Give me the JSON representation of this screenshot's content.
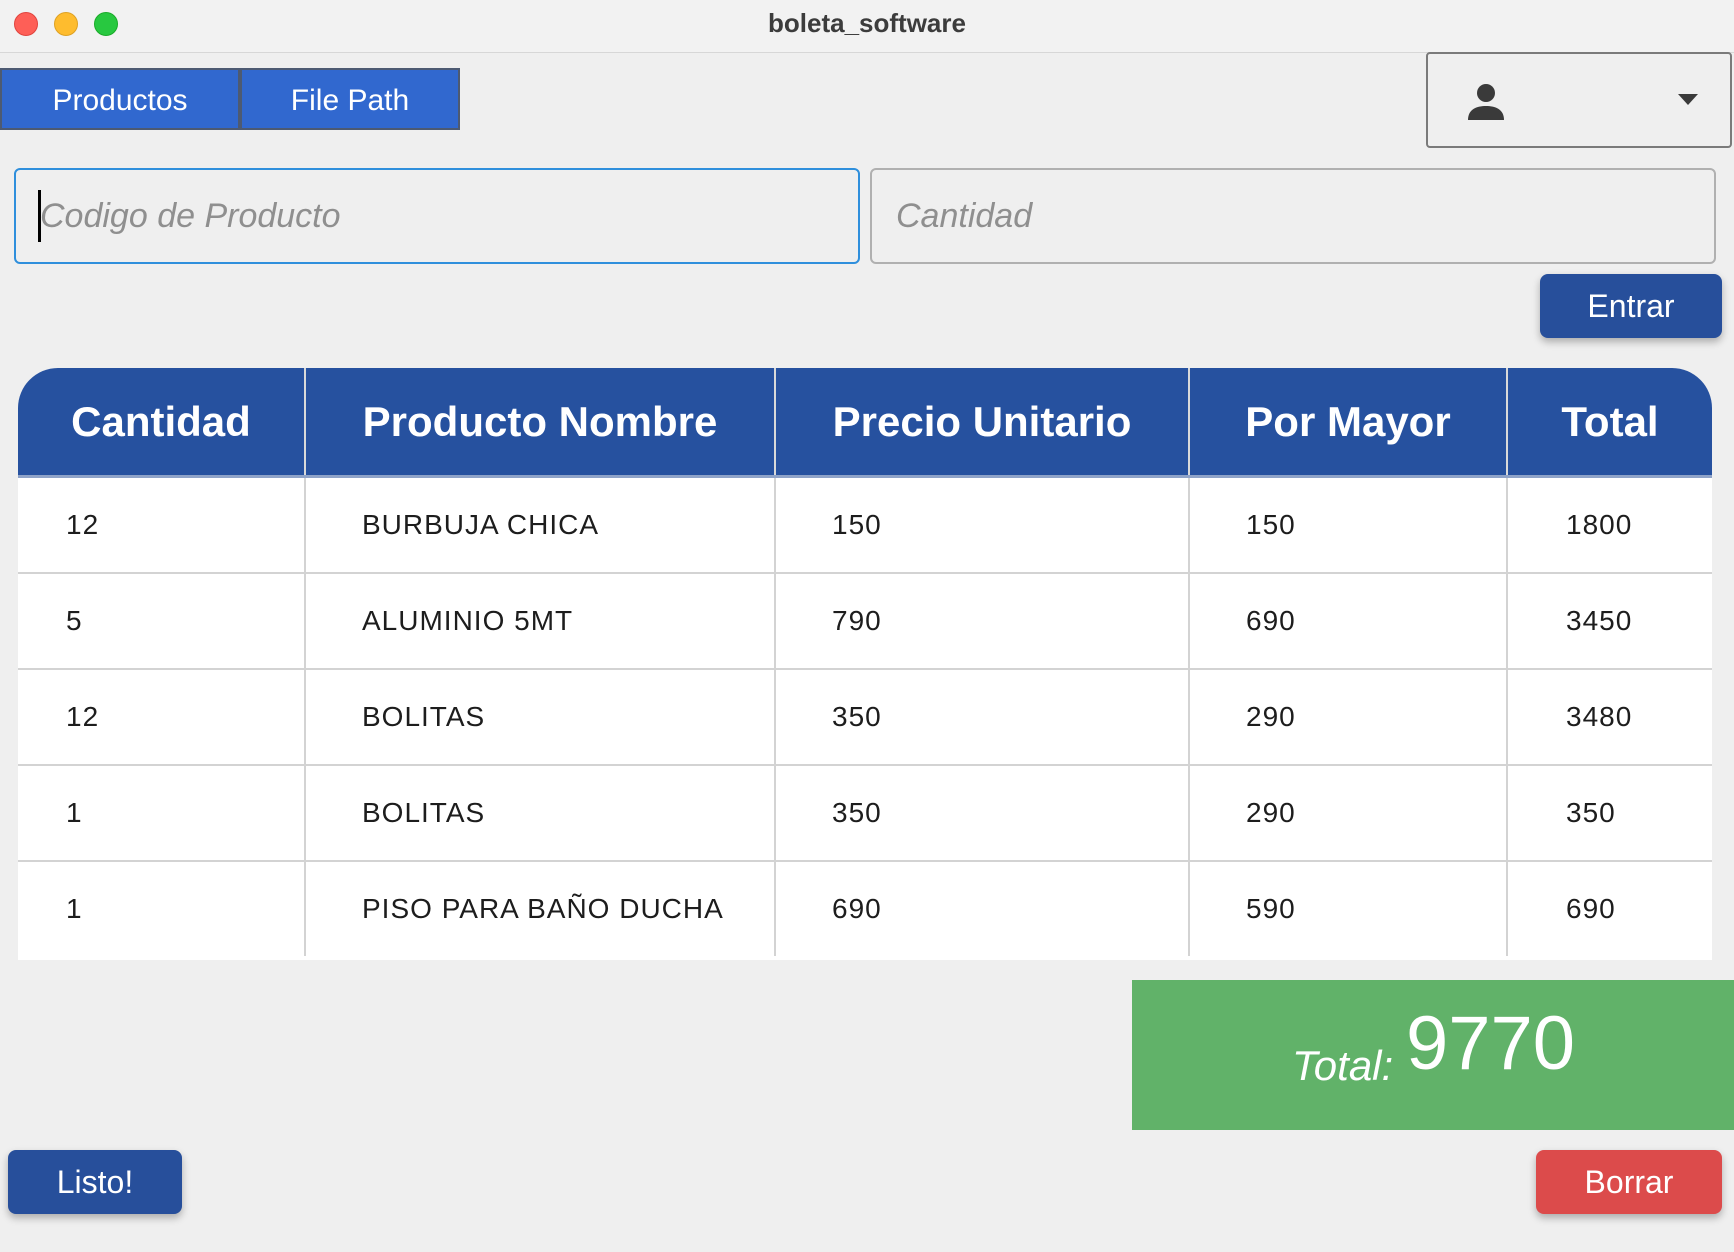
{
  "window": {
    "title": "boleta_software"
  },
  "menu": {
    "items": [
      {
        "label": "Productos"
      },
      {
        "label": "File Path"
      }
    ]
  },
  "user_dropdown": {
    "icon": "user-icon"
  },
  "inputs": {
    "codigo": {
      "placeholder": "Codigo de Producto",
      "value": ""
    },
    "cantidad": {
      "placeholder": "Cantidad",
      "value": ""
    }
  },
  "buttons": {
    "entrar": "Entrar",
    "listo": "Listo!",
    "borrar": "Borrar"
  },
  "table": {
    "headers": [
      "Cantidad",
      "Producto Nombre",
      "Precio Unitario",
      "Por Mayor",
      "Total"
    ],
    "rows": [
      [
        "12",
        "BURBUJA CHICA",
        "150",
        "150",
        "1800"
      ],
      [
        "5",
        "ALUMINIO 5MT",
        "790",
        "690",
        "3450"
      ],
      [
        "12",
        "BOLITAS",
        "350",
        "290",
        "3480"
      ],
      [
        "1",
        "BOLITAS",
        "350",
        "290",
        "350"
      ],
      [
        "1",
        "PISO PARA BAÑO DUCHA",
        "690",
        "590",
        "690"
      ]
    ]
  },
  "total": {
    "label": "Total:",
    "value": "9770"
  },
  "colors": {
    "accent_blue": "#274f9b",
    "tab_blue": "#3168cf",
    "total_green": "#61b269",
    "danger_red": "#dc4b4b",
    "focus_border": "#2f8fdc"
  }
}
